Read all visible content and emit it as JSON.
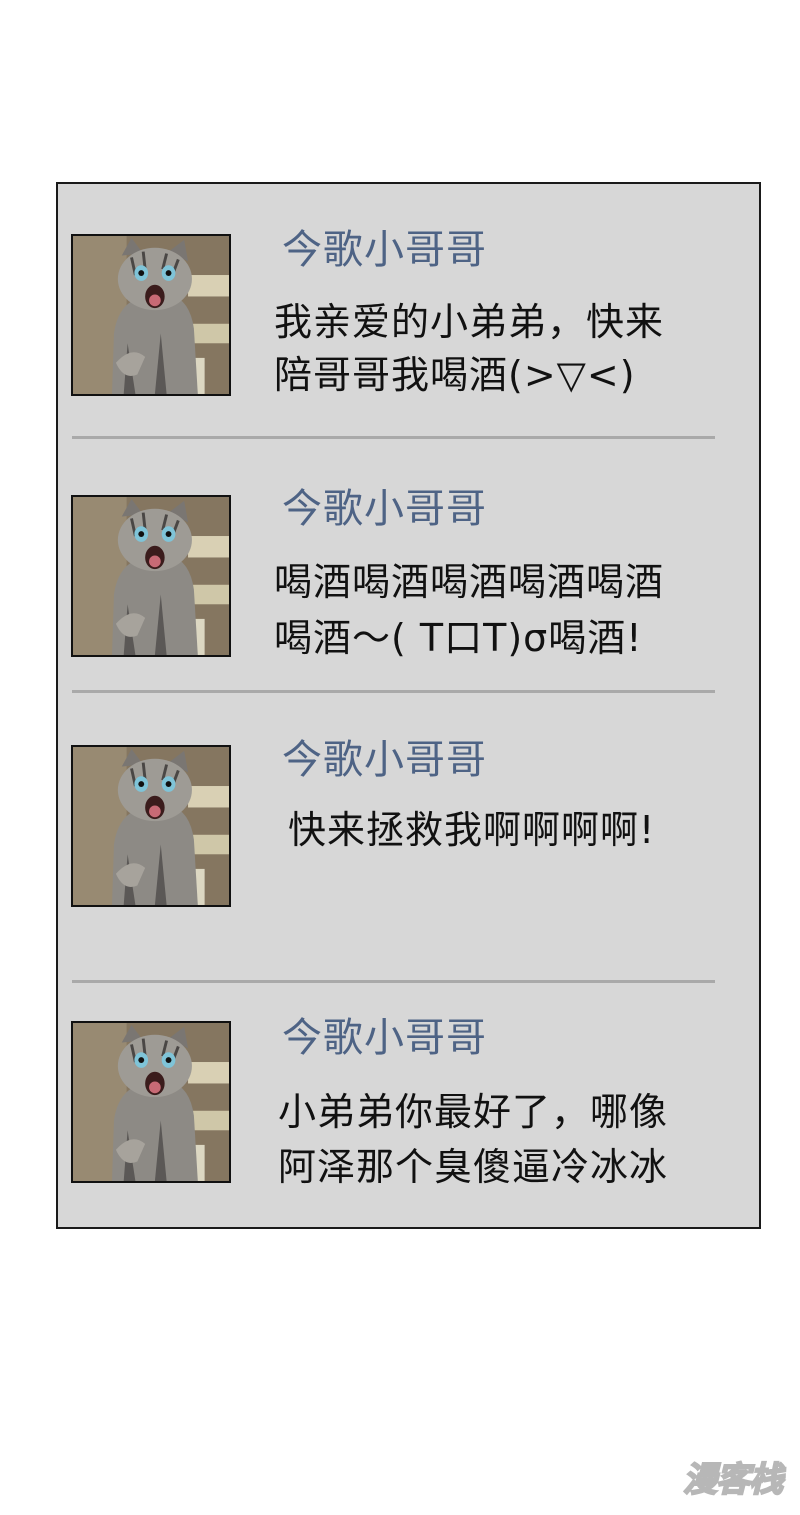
{
  "messages": [
    {
      "sender": "今歌小哥哥",
      "lines": [
        "我亲爱的小弟弟，快来",
        "陪哥哥我喝酒(>▽<)"
      ]
    },
    {
      "sender": "今歌小哥哥",
      "lines": [
        "喝酒喝酒喝酒喝酒喝酒",
        "喝酒～(  T口T)σ喝酒!"
      ]
    },
    {
      "sender": "今歌小哥哥",
      "lines": [
        "快来拯救我啊啊啊啊!"
      ]
    },
    {
      "sender": "今歌小哥哥",
      "lines": [
        "小弟弟你最好了，哪像",
        "阿泽那个臭傻逼冷冰冰"
      ]
    }
  ],
  "avatar": {
    "icon": "screaming-cat-avatar-icon"
  },
  "watermark": "漫客栈",
  "colors": {
    "panel_bg": "#d7d7d7",
    "sender_name": "#4e6385",
    "divider": "#a9a9a9"
  }
}
